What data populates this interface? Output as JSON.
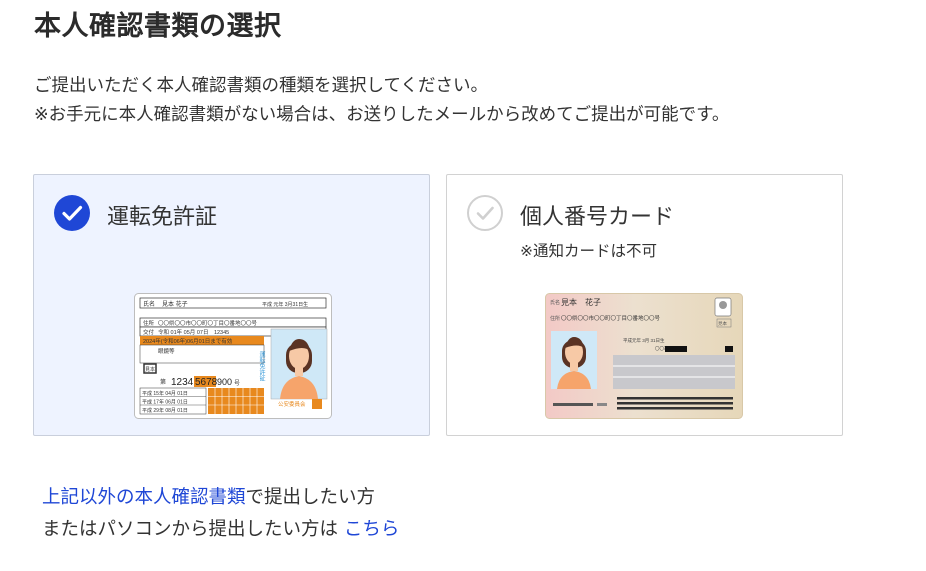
{
  "page": {
    "title": "本人確認書類の選択",
    "description_line1": "ご提出いただく本人確認書類の種類を選択してください。",
    "description_line2": "※お手元に本人確認書類がない場合は、お送りしたメールから改めてご提出が可能です。"
  },
  "options": [
    {
      "label": "運転免許証",
      "selected": true,
      "icon": "check-circle-filled-icon",
      "card_text": {
        "header_name_tag": "氏名",
        "name": "見本 花子",
        "birth": "平成 元年 3月31日生",
        "address_tag": "住所",
        "address": "〇〇県〇〇市〇〇町〇丁目〇番地〇〇号",
        "issue_tag": "交付",
        "issue": "令和 01年 05月 07日　12345",
        "validity": "2024年(令和06年)06月01日まで有効",
        "condition": "眼鏡等",
        "sample": "見本",
        "number_tag": "第",
        "number_a": "1234",
        "number_b": "5678",
        "number_c": "900",
        "number_d": "号",
        "history1": "平成 15年 04月 01日",
        "history2": "平成 17年 06月 01日",
        "history3": "平成 29年 08月 01日",
        "type_vertical": "運転免許証",
        "authority": "公安委員会"
      }
    },
    {
      "label": "個人番号カード",
      "note": "※通知カードは不可",
      "selected": false,
      "icon": "check-circle-outline-icon",
      "card_text": {
        "name_tag": "氏名",
        "name": "見本　花子",
        "address_tag": "住所",
        "address": "〇〇県〇〇市〇〇町〇丁目〇番地〇〇号",
        "note1": "平成元年 3月 31日生",
        "note2": "〇〇市長",
        "sample": "見本"
      }
    }
  ],
  "footer": {
    "link1": "上記以外の本人確認書類",
    "text1": "で提出したい方",
    "text2": "またはパソコンから提出したい方は ",
    "link2": "こちら"
  },
  "colors": {
    "accent": "#1f47d6",
    "selected_bg": "#eef3ff",
    "license_orange": "#e8891e",
    "license_blue": "#3a9bd9",
    "mynumber_pink": "#f3c9c6",
    "mynumber_beige": "#e9dcc3"
  }
}
